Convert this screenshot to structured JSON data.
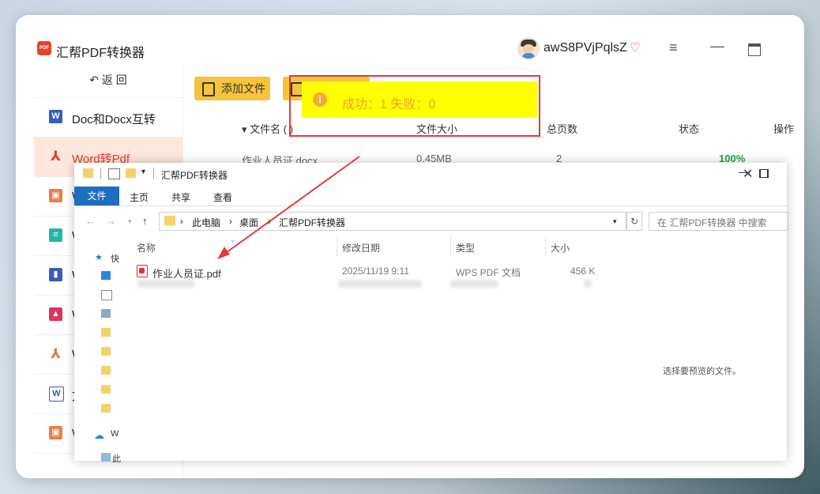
{
  "app": {
    "title": "汇帮PDF转换器",
    "logo_text": "PDF",
    "username": "awS8PVjPqlsZ",
    "back_label": "返  回"
  },
  "sidebar": {
    "items": [
      {
        "label": "Doc和Docx互转",
        "icon": "word-doc-icon",
        "color": "#2f5eb8"
      },
      {
        "label": "Word转Pdf",
        "icon": "pdf-acrobat-icon",
        "color": "#e53d2f",
        "active": true
      },
      {
        "label": "W",
        "icon": "image-icon",
        "color": "#e97d45"
      },
      {
        "label": "W",
        "icon": "document-green-icon",
        "color": "#21b8a0"
      },
      {
        "label": "W",
        "icon": "ppt-icon",
        "color": "#3d5bb0"
      },
      {
        "label": "W",
        "icon": "picture-icon",
        "color": "#d8345c"
      },
      {
        "label": "W",
        "icon": "pdf-acrobat-icon",
        "color": "#e77a2e"
      },
      {
        "label": "文",
        "icon": "word-outline-icon",
        "color": "#2f5eb8"
      },
      {
        "label": "W",
        "icon": "image-icon",
        "color": "#e97d45"
      }
    ]
  },
  "toolbar": {
    "add_label": "添加文件"
  },
  "table": {
    "headers": [
      "▾ 文件名 ( )",
      "文件大小",
      "总页数",
      "状态",
      "操作"
    ],
    "row": {
      "name": "作业人员证.docx",
      "size": "0.45MB",
      "pages": "2",
      "status": "100%"
    }
  },
  "toast": {
    "text": "成功：1   失败：0",
    "icon": "info-icon"
  },
  "explorer": {
    "title": "汇帮PDF转换器",
    "tabs": [
      "文件",
      "主页",
      "共享",
      "查看"
    ],
    "breadcrumb": [
      "此电脑",
      "桌面",
      "汇帮PDF转换器"
    ],
    "search_placeholder": "在 汇帮PDF转换器 中搜索",
    "columns": [
      "名称",
      "修改日期",
      "类型",
      "大小"
    ],
    "file": {
      "name": "作业人员证.pdf",
      "date": "2025/11/19 9:11",
      "type": "WPS PDF 文档",
      "size": "456 K"
    },
    "nav_labels": [
      "快",
      "W",
      "此"
    ],
    "preview_text": "选择要预览的文件。"
  },
  "colors": {
    "accent": "#f6c33c",
    "highlight": "#ffff00",
    "annotation": "#e13a3a",
    "active_bg": "#fde7dd"
  }
}
